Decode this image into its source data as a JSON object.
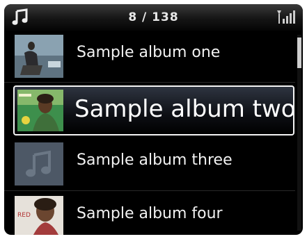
{
  "statusbar": {
    "counter": "8 / 138",
    "left_icon": "music-note-icon",
    "right_icon": "signal-strength-icon"
  },
  "albums": [
    {
      "label": "Sample album one",
      "cover": "album-cover-one"
    },
    {
      "label": "Sample album two",
      "cover": "album-cover-two"
    },
    {
      "label": "Sample album three",
      "cover": "album-cover-placeholder"
    },
    {
      "label": "Sample album four",
      "cover": "album-cover-four"
    }
  ],
  "selected_index": 1,
  "cover_text_four": "RED",
  "colors": {
    "background": "#000000",
    "highlight_border": "#f5f5f5",
    "text": "#f2f2f2"
  }
}
